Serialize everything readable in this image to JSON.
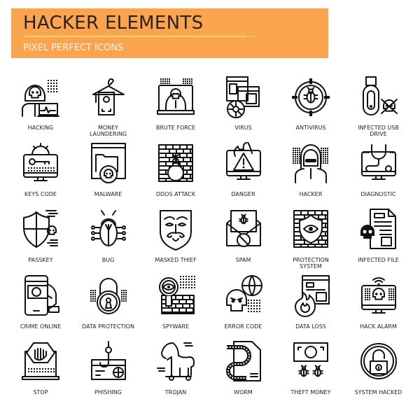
{
  "banner": {
    "title": "HACKER ELEMENTS",
    "subtitle": "PIXEL PERFECT ICONS",
    "background_color": "#fba44f",
    "title_color": "#2a2320",
    "subtitle_color": "#fff6e6"
  },
  "icons": [
    {
      "label": "HACKING",
      "icon": "hacker-skull-laptop-icon"
    },
    {
      "label": "MONEY LAUNDERING",
      "icon": "money-hanger-icon"
    },
    {
      "label": "BRUTE FORCE",
      "icon": "hacker-monitor-icon"
    },
    {
      "label": "VIRUS",
      "icon": "virus-windows-icon"
    },
    {
      "label": "ANTIVIRUS",
      "icon": "bug-crosshair-icon"
    },
    {
      "label": "INFECTED USB DRIVE",
      "icon": "usb-skull-icon"
    },
    {
      "label": "KEYS CODE",
      "icon": "key-monitor-gear-icon"
    },
    {
      "label": "MALWARE",
      "icon": "folder-skull-window-icon"
    },
    {
      "label": "DDOS ATTACK",
      "icon": "bomb-wall-icon"
    },
    {
      "label": "DANGER",
      "icon": "warning-fire-monitor-icon"
    },
    {
      "label": "HACKER",
      "icon": "hooded-hacker-icon"
    },
    {
      "label": "DIAGNOSTIC",
      "icon": "stethoscope-monitor-icon"
    },
    {
      "label": "PASSKEY",
      "icon": "shield-skull-key-icon"
    },
    {
      "label": "BUG",
      "icon": "circuit-bug-icon"
    },
    {
      "label": "MASKED THIEF",
      "icon": "guy-fawkes-mask-icon"
    },
    {
      "label": "SPAM",
      "icon": "envelope-bug-block-icon"
    },
    {
      "label": "PROTECTION SYSTEM",
      "icon": "firewall-eye-shield-icon"
    },
    {
      "label": "INFECTED FILE",
      "icon": "document-skull-icon"
    },
    {
      "label": "CRIME ONLINE",
      "icon": "phone-money-hand-icon"
    },
    {
      "label": "DATA PROTECTION",
      "icon": "padlock-data-icon"
    },
    {
      "label": "SPYWARE",
      "icon": "magnifier-eye-wall-icon"
    },
    {
      "label": "ERROR CODE",
      "icon": "skull-globe-code-icon"
    },
    {
      "label": "DATA LOSS",
      "icon": "window-fire-icon"
    },
    {
      "label": "HACK ALARM",
      "icon": "monitor-skull-wifi-icon"
    },
    {
      "label": "STOP",
      "icon": "laptop-hand-stop-icon"
    },
    {
      "label": "PHISHING",
      "icon": "card-fishhook-icon"
    },
    {
      "label": "TROJAN",
      "icon": "trojan-horse-icon"
    },
    {
      "label": "WORM",
      "icon": "worm-document-icon"
    },
    {
      "label": "THEFT MONEY",
      "icon": "banknote-bugs-icon"
    },
    {
      "label": "SYSTEM HACKED",
      "icon": "unlocked-padlock-circle-icon"
    }
  ]
}
